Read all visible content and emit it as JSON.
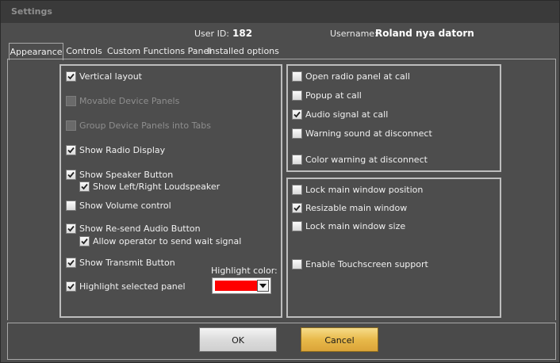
{
  "window": {
    "title": "Settings"
  },
  "info": {
    "user_id_label": "User ID:",
    "user_id_value": "182",
    "username_label": "Username:",
    "username_value": "Roland nya datorn"
  },
  "tabs": [
    {
      "label": "Appearance",
      "active": true
    },
    {
      "label": "Controls",
      "active": false
    },
    {
      "label": "Custom Functions Panel",
      "active": false
    },
    {
      "label": "Installed options",
      "active": false
    }
  ],
  "left_group": {
    "items": [
      {
        "label": "Vertical layout",
        "checked": true,
        "enabled": true
      },
      {
        "label": "Movable Device Panels",
        "checked": false,
        "enabled": false
      },
      {
        "label": "Group Device Panels into Tabs",
        "checked": false,
        "enabled": false
      },
      {
        "label": "Show Radio Display",
        "checked": true,
        "enabled": true
      },
      {
        "label": "Show Speaker Button",
        "checked": true,
        "enabled": true
      },
      {
        "label": "Show Left/Right Loudspeaker",
        "checked": true,
        "enabled": true
      },
      {
        "label": "Show Volume control",
        "checked": false,
        "enabled": true
      },
      {
        "label": "Show Re-send Audio Button",
        "checked": true,
        "enabled": true
      },
      {
        "label": "Allow operator to send wait signal",
        "checked": true,
        "enabled": true
      },
      {
        "label": "Show Transmit Button",
        "checked": true,
        "enabled": true
      },
      {
        "label": "Highlight selected panel",
        "checked": true,
        "enabled": true
      }
    ],
    "highlight_color_label": "Highlight color:",
    "highlight_color": "#ff0000"
  },
  "right_top_group": {
    "items": [
      {
        "label": "Open radio panel at call",
        "checked": false,
        "enabled": true
      },
      {
        "label": "Popup at call",
        "checked": false,
        "enabled": true
      },
      {
        "label": "Audio signal at call",
        "checked": true,
        "enabled": true
      },
      {
        "label": "Warning sound at disconnect",
        "checked": false,
        "enabled": true
      },
      {
        "label": "Color warning at disconnect",
        "checked": false,
        "enabled": true
      }
    ]
  },
  "right_bottom_group": {
    "items": [
      {
        "label": "Lock main window position",
        "checked": false,
        "enabled": true
      },
      {
        "label": "Resizable main window",
        "checked": true,
        "enabled": true
      },
      {
        "label": "Lock main window size",
        "checked": false,
        "enabled": true
      },
      {
        "label": "Enable Touchscreen support",
        "checked": false,
        "enabled": true
      }
    ]
  },
  "buttons": {
    "ok": "OK",
    "cancel": "Cancel"
  }
}
